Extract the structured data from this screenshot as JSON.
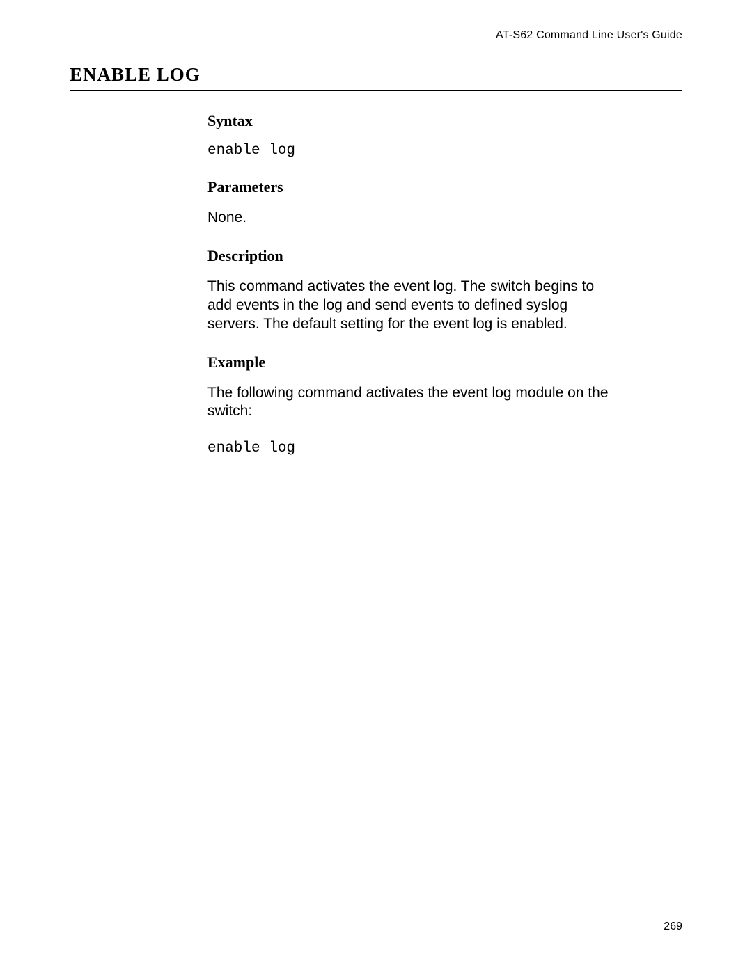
{
  "header": {
    "running_title": "AT-S62 Command Line User's Guide"
  },
  "title": "ENABLE LOG",
  "sections": {
    "syntax": {
      "heading": "Syntax",
      "code": "enable log"
    },
    "parameters": {
      "heading": "Parameters",
      "text": "None."
    },
    "description": {
      "heading": "Description",
      "text": "This command activates the event log. The switch begins to add events in the log and send events to defined syslog servers. The default setting for the event log is enabled."
    },
    "example": {
      "heading": "Example",
      "text": "The following command activates the event log module on the switch:",
      "code": "enable log"
    }
  },
  "page_number": "269"
}
